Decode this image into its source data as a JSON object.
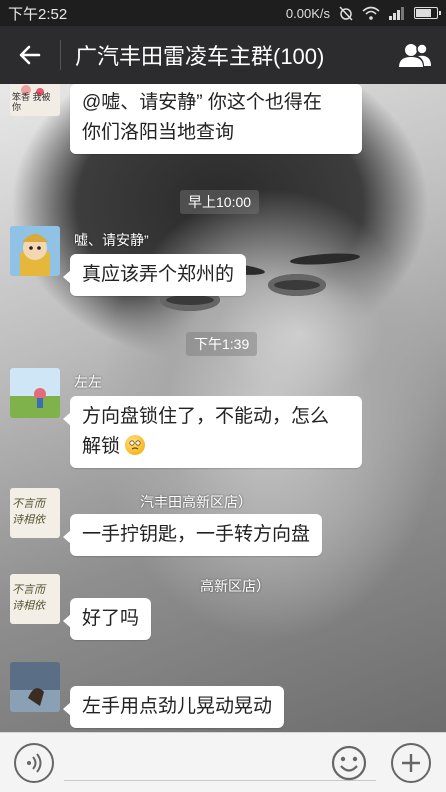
{
  "status_bar": {
    "time": "下午2:52",
    "net_speed": "0.00K/s",
    "icons": [
      "alarm-off-icon",
      "wifi-icon",
      "signal-icon",
      "battery-icon"
    ]
  },
  "header": {
    "title": "广汽丰田雷凌车主群(100)",
    "back_icon": "back-arrow-icon",
    "members_icon": "group-members-icon"
  },
  "messages": [
    {
      "sender": "",
      "avatar_caption": "笨香 我被你",
      "text_line1": "@嘘、请安静” 你这个也得在",
      "text_line2": "你们洛阳当地查询"
    },
    {
      "type": "time",
      "text": "早上10:00"
    },
    {
      "sender": "嘘、请安静”",
      "text": "真应该弄个郑州的"
    },
    {
      "type": "time",
      "text": "下午1:39"
    },
    {
      "sender": "左左",
      "text_line1": "方向盘锁住了，不能动，怎么",
      "text_line2": "解锁",
      "emoji": "confused-face-emoji"
    },
    {
      "sender": "汽丰田高新区店）",
      "avatar_caption": "不言而 诗相依",
      "text": "一手拧钥匙，一手转方向盘"
    },
    {
      "sender": "高新区店）",
      "avatar_caption": "不言而 诗相依",
      "text": "好了吗"
    },
    {
      "sender": "",
      "text": "左手用点劲儿晃动晃动"
    }
  ],
  "input_bar": {
    "placeholder": "",
    "voice_icon": "voice-icon",
    "emoji_icon": "emoji-icon",
    "plus_icon": "plus-icon"
  }
}
